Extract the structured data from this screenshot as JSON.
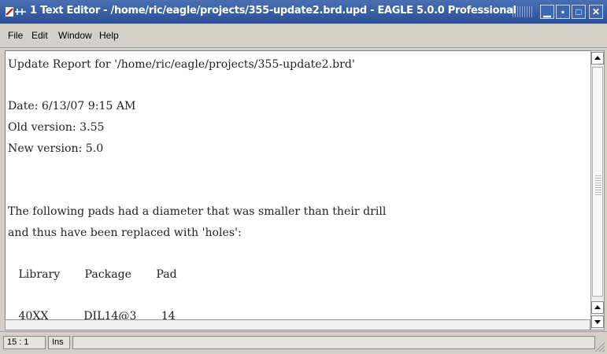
{
  "window": {
    "title": "1 Text Editor - /home/ric/eagle/projects/355-update2.brd.upd - EAGLE 5.0.0 Professional",
    "minimize_glyph": "▁",
    "restore_glyph": "▪",
    "maximize_glyph": "□",
    "close_glyph": "✕"
  },
  "menu": {
    "items": [
      {
        "label": "File"
      },
      {
        "label": "Edit"
      },
      {
        "label": "Window"
      },
      {
        "label": "Help"
      }
    ]
  },
  "document": {
    "text": "Update Report for '/home/ric/eagle/projects/355-update2.brd'\n\nDate: 6/13/07 9:15 AM\nOld version: 3.55\nNew version: 5.0\n\n\nThe following pads had a diameter that was smaller than their drill\nand thus have been replaced with 'holes':\n\n   Library       Package       Pad\n\n   40XX          DIL14@3       14"
  },
  "status": {
    "position": "15 : 1",
    "mode": "Ins",
    "message": ""
  },
  "icons": {
    "app_icon": "eagle-app-icon",
    "scroll_up": "arrow-up-icon",
    "scroll_down": "arrow-down-icon"
  }
}
